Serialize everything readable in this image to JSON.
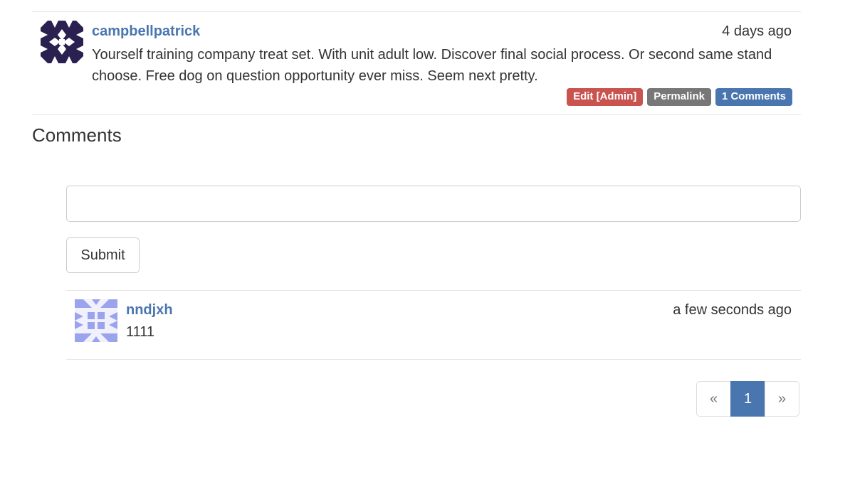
{
  "post": {
    "author": "campbellpatrick",
    "time": "4 days ago",
    "body": "Yourself training company treat set. With unit adult low. Discover final social process. Or second same stand choose. Free dog on question opportunity ever miss. Seem next pretty.",
    "labels": {
      "edit": "Edit [Admin]",
      "permalink": "Permalink",
      "comments": "1 Comments"
    },
    "avatar_colors": {
      "fg": "#2b2150",
      "bg": "#ffffff"
    }
  },
  "comments_section": {
    "heading": "Comments",
    "input_value": "",
    "input_placeholder": "",
    "submit_label": "Submit"
  },
  "comments": [
    {
      "author": "nndjxh",
      "time": "a few seconds ago",
      "body": "1111",
      "avatar_colors": {
        "fg": "#9aa3ec",
        "bg": "#f0f1fc"
      }
    }
  ],
  "pagination": {
    "prev": "«",
    "current": "1",
    "next": "»"
  },
  "colors": {
    "accent": "#4a76b0",
    "danger": "#c9534f",
    "default": "#777777"
  }
}
